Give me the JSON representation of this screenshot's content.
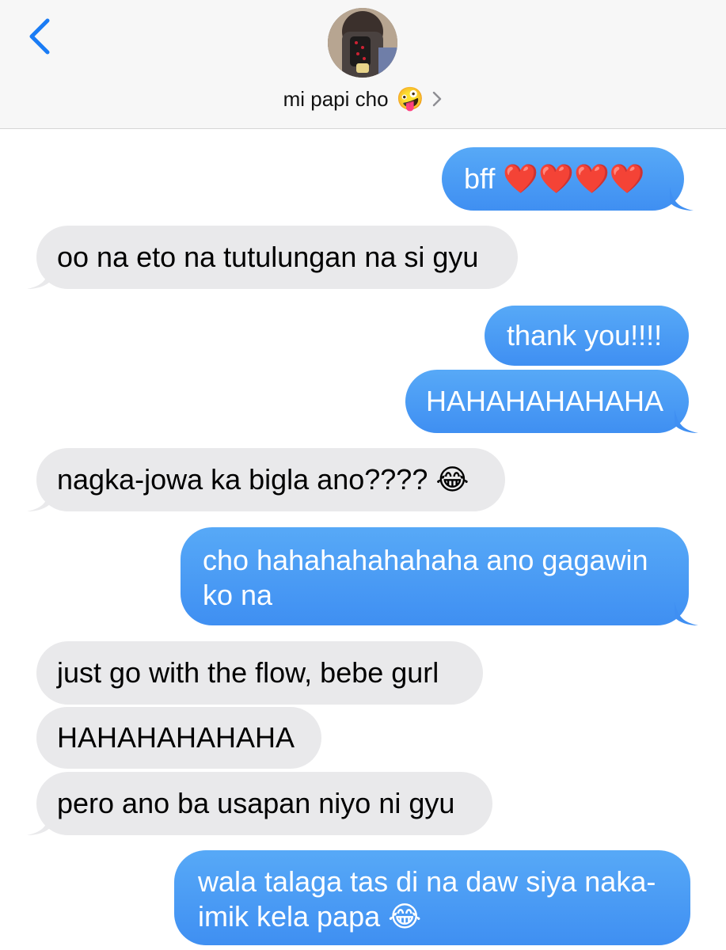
{
  "header": {
    "back_icon": "chevron-left-icon",
    "contact_name": "mi papi cho",
    "contact_emoji": "🤪",
    "chevron_icon": "chevron-right-icon"
  },
  "colors": {
    "sent_bubble": "#4a9bf5",
    "received_bubble": "#e9e9eb",
    "accent": "#1a7cf5"
  },
  "messages": [
    {
      "side": "sent",
      "text": "bff ❤️❤️❤️❤️"
    },
    {
      "side": "received",
      "text": "oo na eto na tutulungan na si gyu"
    },
    {
      "side": "sent",
      "text": "thank you!!!!"
    },
    {
      "side": "sent",
      "text": "HAHAHAHAHAHA"
    },
    {
      "side": "received",
      "text": "nagka-jowa ka bigla ano???? 😂"
    },
    {
      "side": "sent",
      "text": "cho hahahahahahaha ano gagawin ko na"
    },
    {
      "side": "received",
      "text": "just go with the flow, bebe gurl"
    },
    {
      "side": "received",
      "text": "HAHAHAHAHAHA"
    },
    {
      "side": "received",
      "text": "pero ano ba usapan niyo ni gyu"
    },
    {
      "side": "sent",
      "text": "wala talaga tas di na daw siya naka-imik kela papa 😂"
    }
  ]
}
